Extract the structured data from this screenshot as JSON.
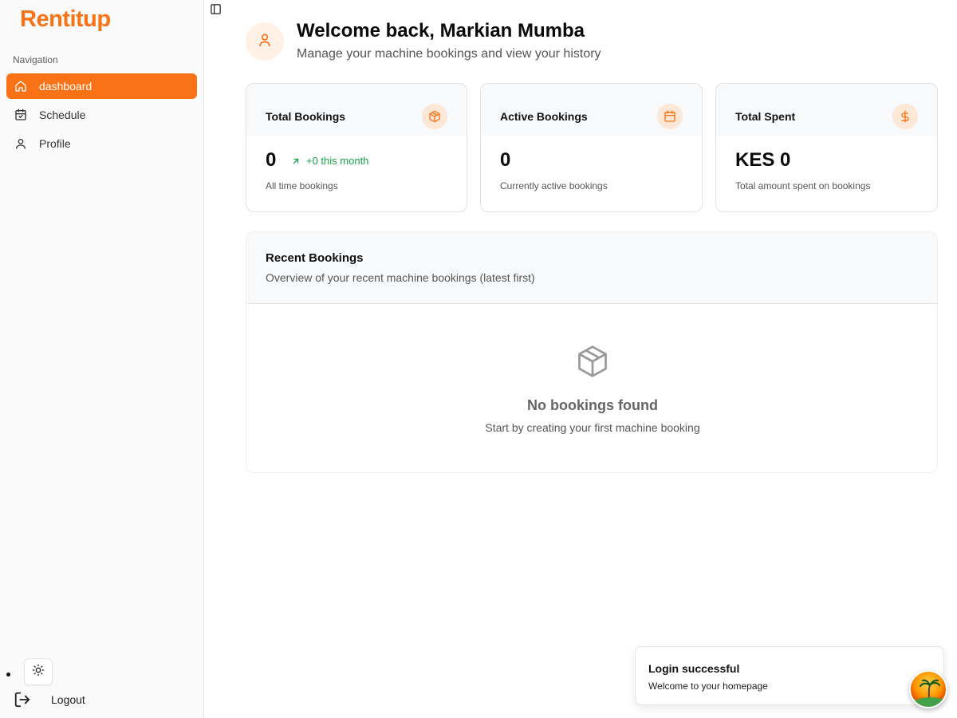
{
  "brand": {
    "name": "Rentitup"
  },
  "sidebar": {
    "nav_label": "Navigation",
    "items": [
      {
        "label": "dashboard",
        "icon": "home-icon",
        "active": true
      },
      {
        "label": "Schedule",
        "icon": "calendar-check-icon",
        "active": false
      },
      {
        "label": "Profile",
        "icon": "user-icon",
        "active": false
      }
    ],
    "logout_label": "Logout"
  },
  "header": {
    "title": "Welcome back, Markian Mumba",
    "subtitle": "Manage your machine bookings and view your history"
  },
  "stats": [
    {
      "title": "Total Bookings",
      "value": "0",
      "trend": "+0 this month",
      "description": "All time bookings",
      "icon": "package-icon"
    },
    {
      "title": "Active Bookings",
      "value": "0",
      "description": "Currently active bookings",
      "icon": "calendar-icon"
    },
    {
      "title": "Total Spent",
      "value": "KES 0",
      "description": "Total amount spent on bookings",
      "icon": "dollar-icon"
    }
  ],
  "recent": {
    "title": "Recent Bookings",
    "subtitle": "Overview of your recent machine bookings (latest first)",
    "empty_title": "No bookings found",
    "empty_subtitle": "Start by creating your first machine booking"
  },
  "toast": {
    "title": "Login successful",
    "message": "Welcome to your homepage"
  },
  "colors": {
    "accent": "#f97316",
    "accent_soft": "#fde7d6",
    "trend_green": "#16a34a"
  }
}
